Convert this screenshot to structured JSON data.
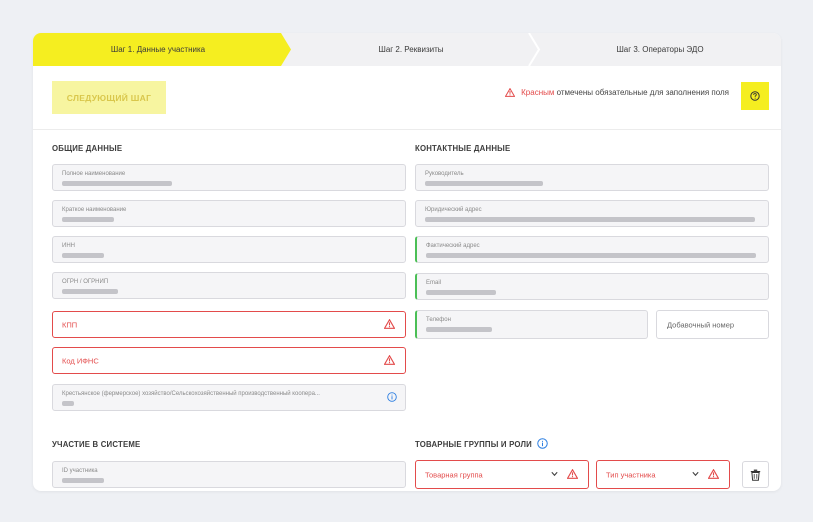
{
  "steps": [
    {
      "label": "Шаг 1. Данные участника",
      "active": true
    },
    {
      "label": "Шаг 2. Реквизиты",
      "active": false
    },
    {
      "label": "Шаг 3. Операторы ЭДО",
      "active": false
    }
  ],
  "toolbar": {
    "next_label": "СЛЕДУЮЩИЙ ШАГ",
    "hint_red": "Красным",
    "hint_rest": "отмечены обязательные для заполнения поля"
  },
  "general": {
    "title": "ОБЩИЕ ДАННЫЕ",
    "full_name_label": "Полное наименование",
    "short_name_label": "Краткое наименование",
    "inn_label": "ИНН",
    "ogrn_label": "ОГРН / ОГРНИП",
    "kpp_placeholder": "КПП",
    "ifns_placeholder": "Код ИФНС",
    "farm_label": "Крестьянское (фермерское) хозяйство/Сельскохозяйственный производственный коопера..."
  },
  "contacts": {
    "title": "КОНТАКТНЫЕ ДАННЫЕ",
    "head_label": "Руководитель",
    "legal_address_label": "Юридический адрес",
    "actual_address_label": "Фактический адрес",
    "email_label": "Email",
    "phone_label": "Телефон",
    "ext_placeholder": "Добавочный номер"
  },
  "participation": {
    "title": "УЧАСТИЕ В СИСТЕМЕ",
    "id_label": "ID участника"
  },
  "product_groups": {
    "title": "ТОВАРНЫЕ ГРУППЫ И РОЛИ",
    "group_placeholder": "Товарная группа",
    "type_placeholder": "Тип участника"
  },
  "colors": {
    "accent_yellow": "#f5ee20",
    "error_red": "#e34b4b",
    "valid_green": "#4bbf56"
  }
}
